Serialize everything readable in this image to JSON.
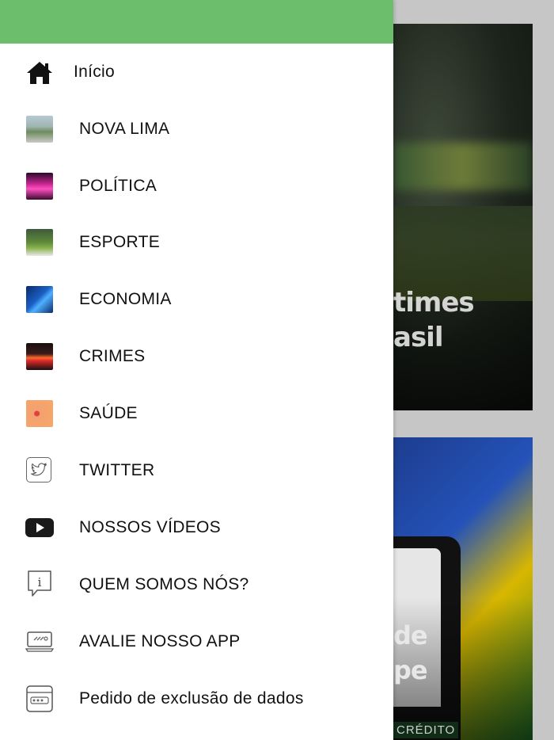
{
  "background": {
    "card1_headline": "times\nasil",
    "card2_headline": "de\npe",
    "card2_credit": "CRÉDITO"
  },
  "drawer": {
    "header_color": "#6cbd6c",
    "items": [
      {
        "label": "Início",
        "icon": "home-icon"
      },
      {
        "label": "NOVA LIMA",
        "icon": "nova-lima-thumbnail"
      },
      {
        "label": "POLÍTICA",
        "icon": "politica-thumbnail"
      },
      {
        "label": "ESPORTE",
        "icon": "esporte-thumbnail"
      },
      {
        "label": "ECONOMIA",
        "icon": "economia-thumbnail"
      },
      {
        "label": "CRIMES",
        "icon": "crimes-thumbnail"
      },
      {
        "label": "SAÚDE",
        "icon": "saude-thumbnail"
      },
      {
        "label": "TWITTER",
        "icon": "twitter-icon"
      },
      {
        "label": "NOSSOS VÍDEOS",
        "icon": "youtube-icon"
      },
      {
        "label": "QUEM SOMOS NÓS?",
        "icon": "info-icon"
      },
      {
        "label": "AVALIE NOSSO APP",
        "icon": "rate-app-icon"
      },
      {
        "label": "Pedido de exclusão de dados",
        "icon": "data-deletion-icon"
      }
    ]
  }
}
